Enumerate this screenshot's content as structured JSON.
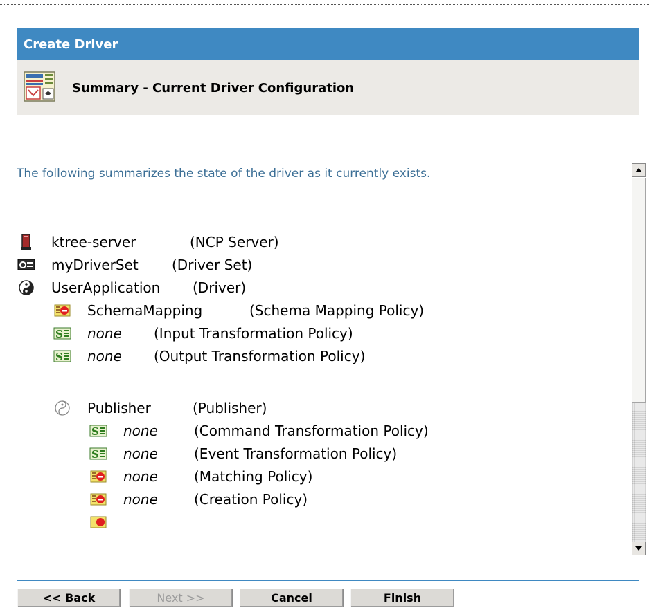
{
  "wizard": {
    "title": "Create Driver",
    "subtitle": "Summary - Current Driver Configuration",
    "intro": "The following summarizes the state of the driver as it currently exists."
  },
  "tree": [
    {
      "icon": "server-icon",
      "name": "ktree-server",
      "type": "(NCP Server)",
      "italic": false
    },
    {
      "icon": "driver-set-icon",
      "name": "myDriverSet",
      "type": "(Driver Set)",
      "italic": false
    },
    {
      "icon": "driver-yin-yang-icon",
      "name": "UserApplication",
      "type": "(Driver)",
      "italic": false
    },
    {
      "icon": "policy-icon",
      "name": "SchemaMapping",
      "type": "(Schema Mapping Policy)",
      "italic": false
    },
    {
      "icon": "stylesheet-icon",
      "name": "none",
      "type": "(Input Transformation Policy)",
      "italic": true
    },
    {
      "icon": "stylesheet-icon",
      "name": "none",
      "type": "(Output Transformation Policy)",
      "italic": true
    },
    {
      "icon": "publisher-icon",
      "name": "Publisher",
      "type": "(Publisher)",
      "italic": false
    },
    {
      "icon": "stylesheet-icon",
      "name": "none",
      "type": "(Command Transformation Policy)",
      "italic": true
    },
    {
      "icon": "stylesheet-icon",
      "name": "none",
      "type": "(Event Transformation Policy)",
      "italic": true
    },
    {
      "icon": "policy-icon",
      "name": "none",
      "type": "(Matching Policy)",
      "italic": true
    },
    {
      "icon": "policy-icon",
      "name": "none",
      "type": "(Creation Policy)",
      "italic": true
    }
  ],
  "buttons": {
    "back": "<< Back",
    "next": "Next >>",
    "cancel": "Cancel",
    "finish": "Finish"
  },
  "colors": {
    "title_bar": "#3f89c2",
    "subheader_bg": "#eceae6",
    "intro_text": "#3c6f96",
    "separator": "#3f89c2"
  }
}
